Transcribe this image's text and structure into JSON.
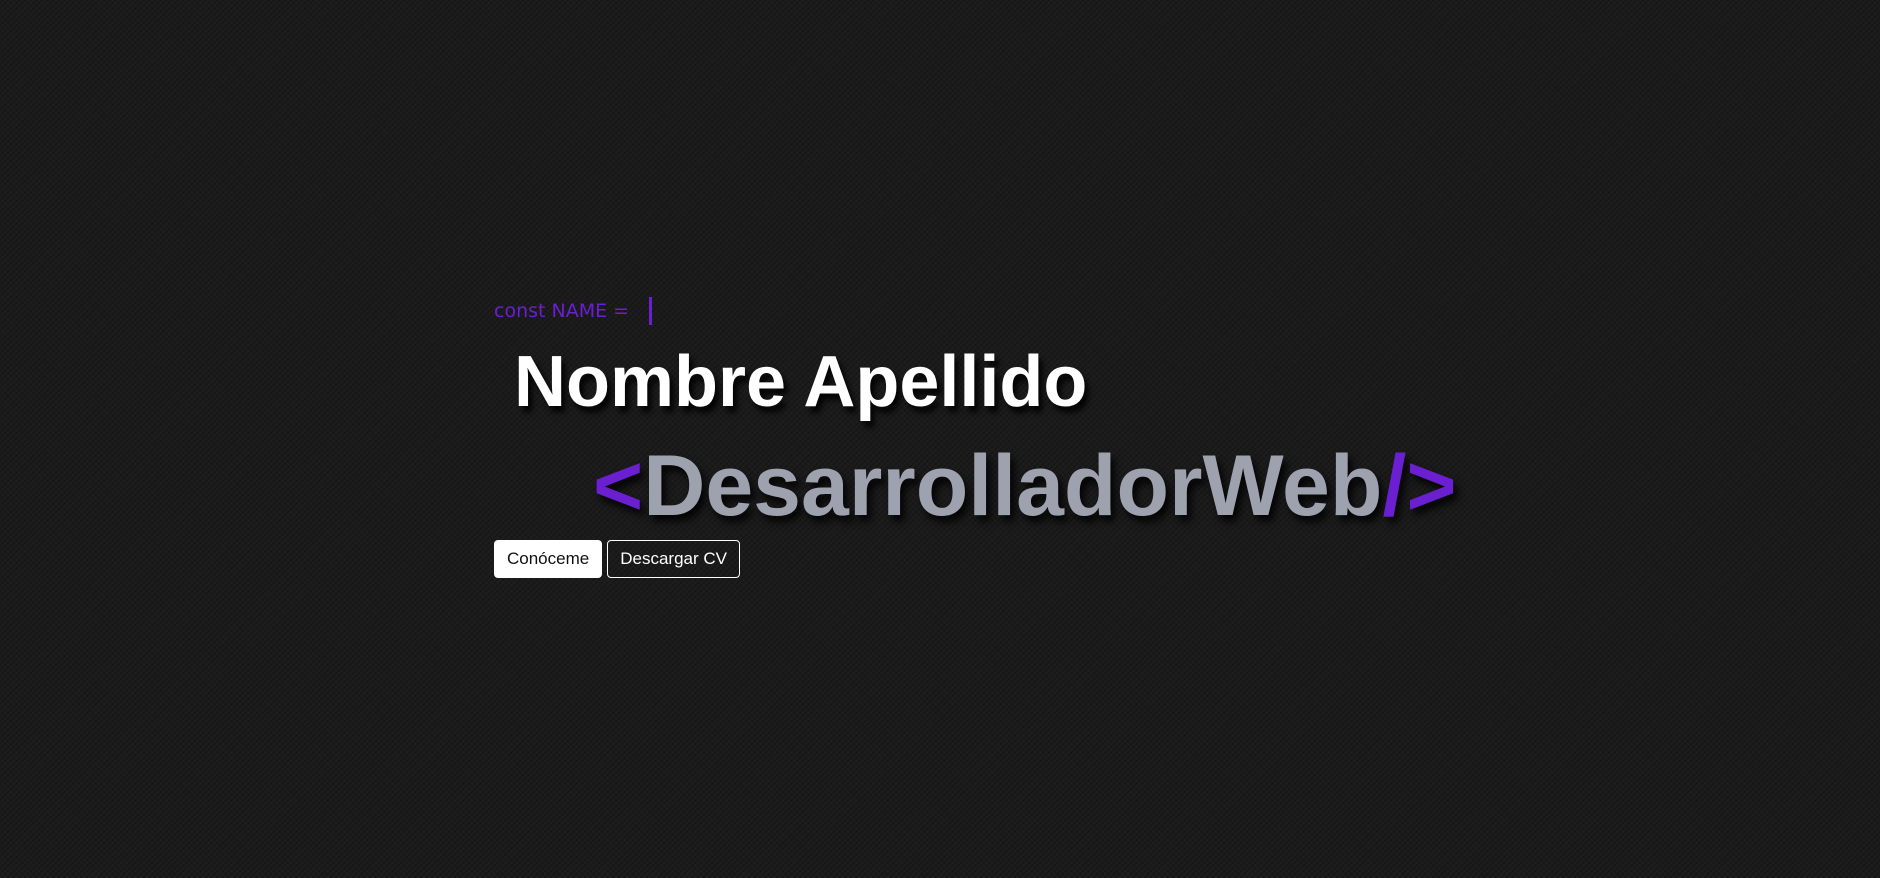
{
  "hero": {
    "const_label": "const NAME =",
    "name": "Nombre Apellido",
    "role": {
      "open_bracket": "<",
      "text": "DesarrolladorWeb",
      "close_bracket": "/>"
    }
  },
  "buttons": {
    "primary_label": "Conóceme",
    "secondary_label": "Descargar CV"
  },
  "colors": {
    "accent": "#6a1fd0",
    "role_text": "#9ea1ae",
    "background": "#1b1b1b"
  }
}
